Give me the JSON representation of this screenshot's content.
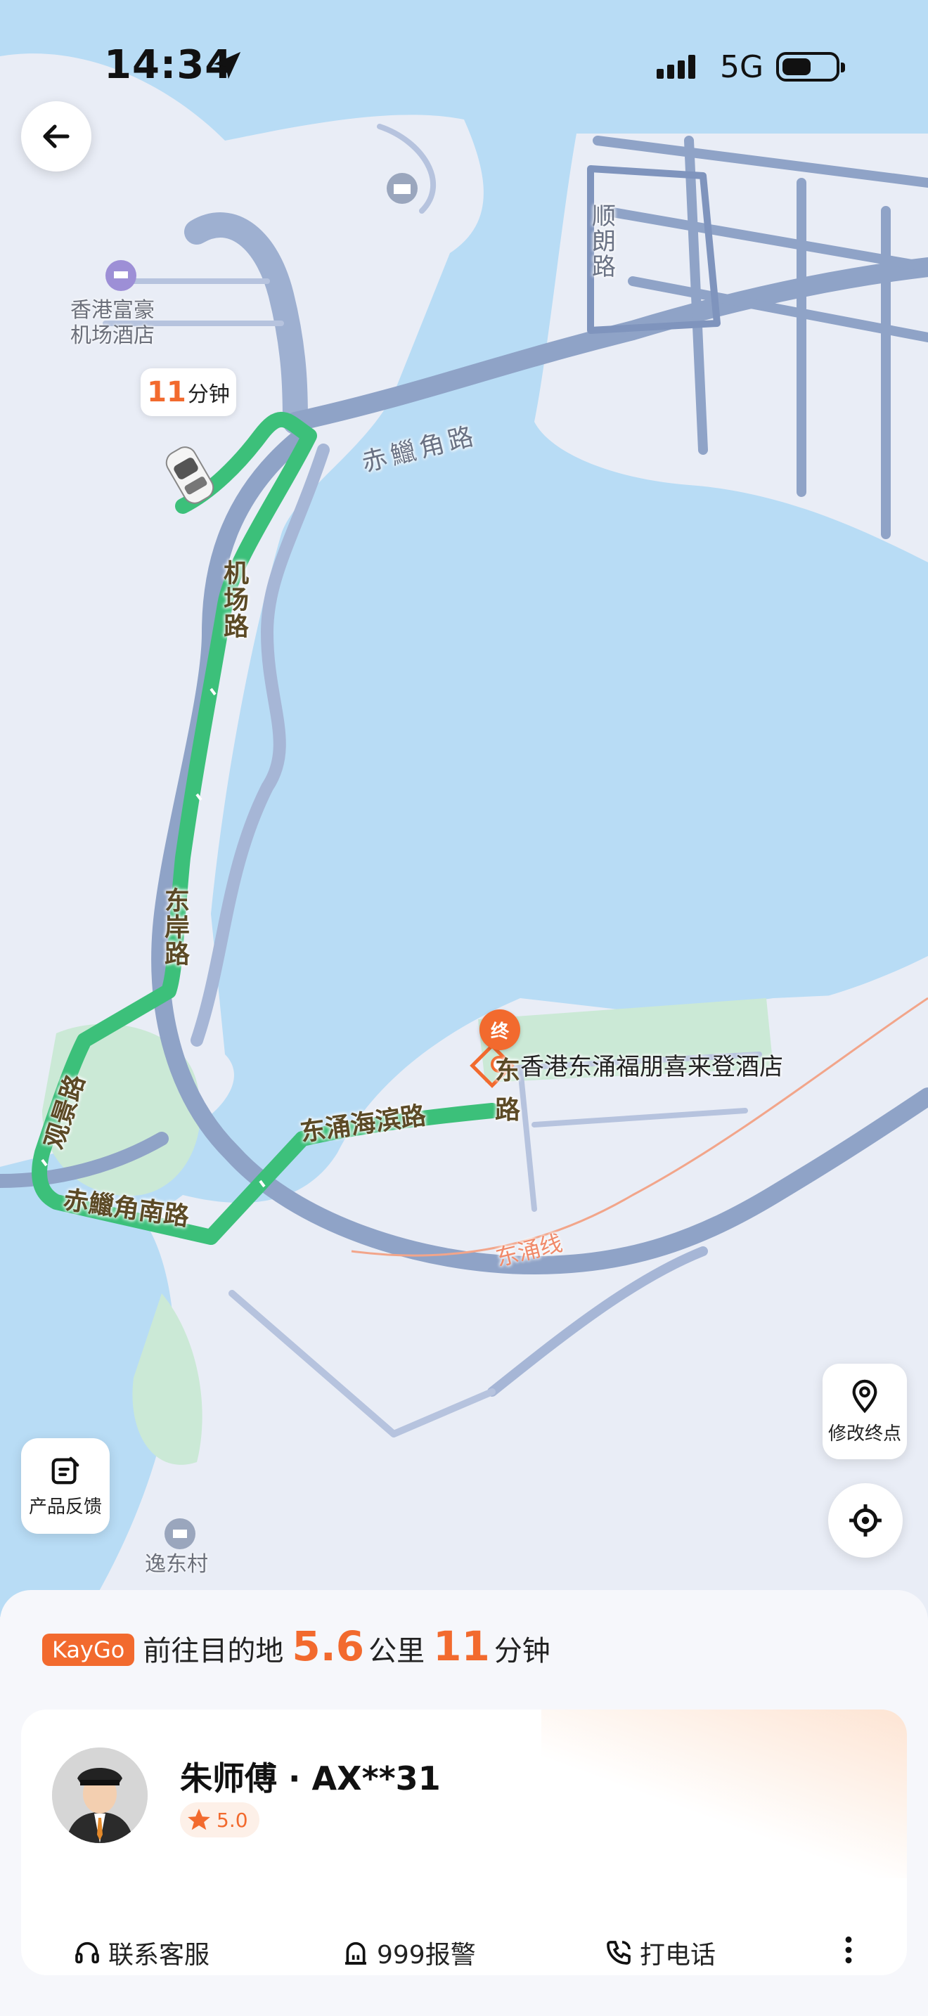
{
  "status_bar": {
    "time": "14:34",
    "network": "5G"
  },
  "map": {
    "eta_bubble": {
      "number": "11",
      "unit": "分钟"
    },
    "places": [
      {
        "name": "香港富豪\n机场酒店"
      },
      {
        "name": "逸东村"
      }
    ],
    "roads": {
      "chek_lap_kok_road": "赤鱲角路",
      "shun_tak_road": "顺\n朗\n路",
      "airport_road": "机场路",
      "east_coast_road": "东岸路",
      "kwun_tung_road": "观景路",
      "chek_lap_kok_south_road": "赤鱲角南路",
      "tung_chung_waterfront_road": "东涌海滨路",
      "fu_tung_road": "东\n路",
      "tung_chung_line": "东涌线"
    },
    "destination": {
      "pin_label": "终",
      "name": "香港东涌福朋喜来登酒店"
    }
  },
  "buttons": {
    "edit_destination": "修改终点",
    "feedback": "产品反馈"
  },
  "trip": {
    "brand": "KayGo",
    "prefix": "前往目的地",
    "distance": "5.6",
    "distance_unit": "公里",
    "duration": "11",
    "duration_unit": "分钟"
  },
  "driver": {
    "name": "朱师傅 · AX**31",
    "rating": "5.0"
  },
  "actions": {
    "customer_service": "联系客服",
    "police": "999报警",
    "call": "打电话"
  },
  "colors": {
    "accent": "#f26a2e",
    "route": "#3cc07a",
    "water": "#b8dcf5",
    "land": "#e9edf6",
    "road": "#8fa3c7"
  }
}
